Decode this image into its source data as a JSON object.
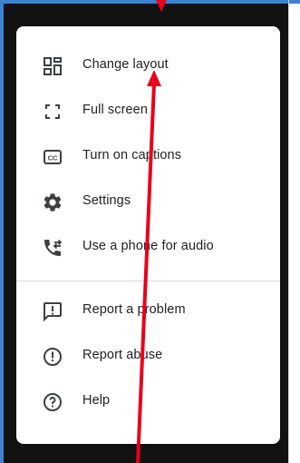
{
  "menu": {
    "items": [
      {
        "label": "Change layout",
        "icon": "layout-icon"
      },
      {
        "label": "Full screen",
        "icon": "fullscreen-icon"
      },
      {
        "label": "Turn on captions",
        "icon": "captions-icon"
      },
      {
        "label": "Settings",
        "icon": "gear-icon"
      },
      {
        "label": "Use a phone for audio",
        "icon": "phone-audio-icon"
      }
    ],
    "secondary_items": [
      {
        "label": "Report a problem",
        "icon": "report-problem-icon"
      },
      {
        "label": "Report abuse",
        "icon": "report-abuse-icon"
      },
      {
        "label": "Help",
        "icon": "help-icon"
      }
    ]
  },
  "colors": {
    "frame": "#3b83d6",
    "backdrop": "#121212",
    "icon": "#3c4043",
    "text": "#202124",
    "annotation": "#e8001c"
  }
}
